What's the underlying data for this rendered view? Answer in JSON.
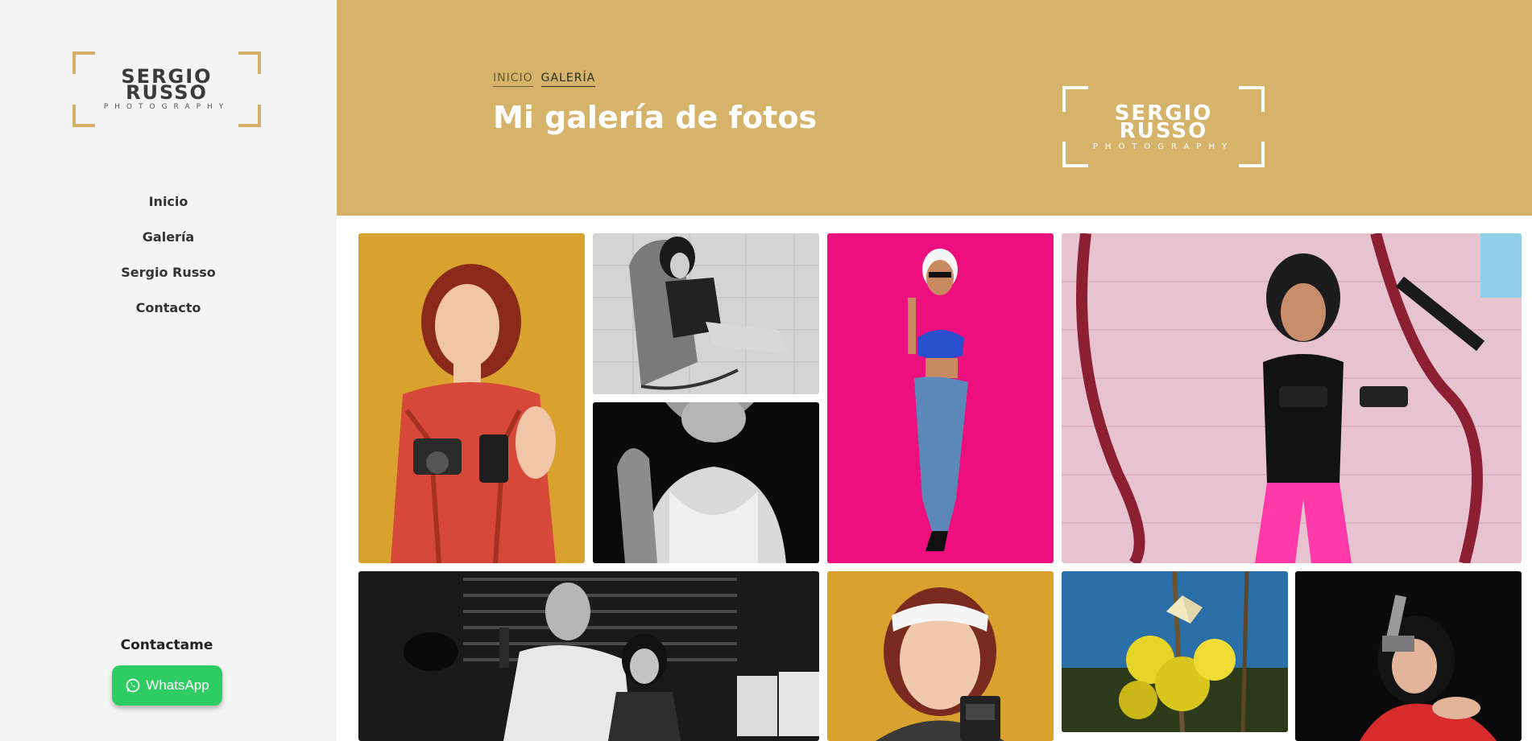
{
  "brand": {
    "logo_line1": "SERGIO",
    "logo_line2": "RUSSO",
    "logo_line3": "PHOTOGRAPHY",
    "accent_color": "#d6b36a"
  },
  "sidebar": {
    "nav": [
      {
        "label": "Inicio"
      },
      {
        "label": "Galería"
      },
      {
        "label": "Sergio Russo"
      },
      {
        "label": "Contacto"
      }
    ],
    "contact_label": "Contactame",
    "whatsapp_label": "WhatsApp",
    "whatsapp_color": "#2ecc63"
  },
  "header": {
    "breadcrumb_home": "INICIO",
    "breadcrumb_current": "GALERÍA",
    "title": "Mi galería de fotos"
  },
  "gallery": {
    "photos": [
      {
        "subject": "woman-red-dress-camera"
      },
      {
        "subject": "woman-rocking-chair-bw"
      },
      {
        "subject": "woman-portrait-bw"
      },
      {
        "subject": "pinup-woman-pink-background"
      },
      {
        "subject": "woman-graffiti-wall"
      },
      {
        "subject": "noir-couple-bw"
      },
      {
        "subject": "woman-headband-camera"
      },
      {
        "subject": "butterfly-yellow-flowers"
      },
      {
        "subject": "woman-red-dress-revolver"
      }
    ]
  }
}
